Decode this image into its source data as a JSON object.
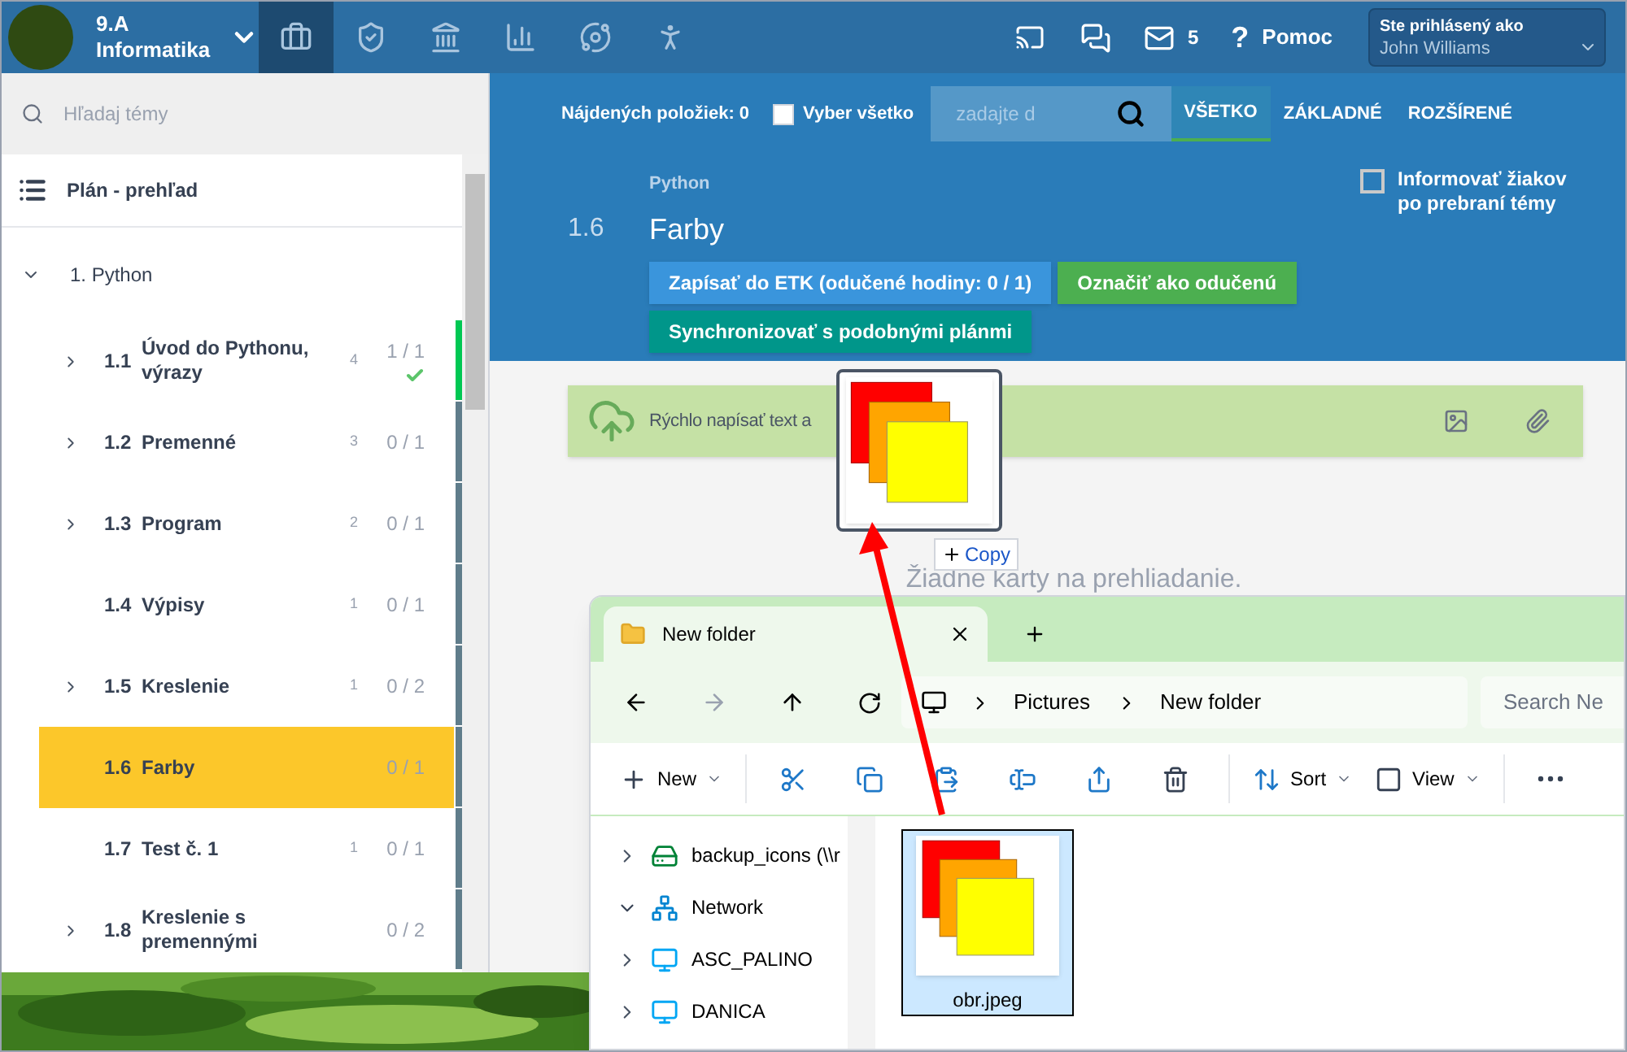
{
  "header": {
    "class_name": "9.A",
    "subject": "Informatika",
    "nav_tabs": [
      {
        "kind": "briefcase",
        "selected": true
      },
      {
        "kind": "shield",
        "selected": false
      },
      {
        "kind": "bank",
        "selected": false
      },
      {
        "kind": "chart",
        "selected": false
      },
      {
        "kind": "orbit",
        "selected": false
      },
      {
        "kind": "walkers",
        "selected": false
      }
    ],
    "messages_count": "5",
    "help_glyph": "?",
    "help": "Pomoc",
    "user": {
      "label": "Ste prihlásený ako",
      "name": "John Williams"
    }
  },
  "sidebar": {
    "search_placeholder": "Hľadaj témy",
    "overview": "Plán - prehľad",
    "group": {
      "title": "1. Python",
      "expanded": true,
      "items": [
        {
          "number": "1.1",
          "title": "Úvod do Pythonu, výrazy",
          "count": "4",
          "progress": "1 / 1",
          "done": true,
          "has_children": true,
          "selected": false
        },
        {
          "number": "1.2",
          "title": "Premenné",
          "count": "3",
          "progress": "0 / 1",
          "done": false,
          "has_children": true,
          "selected": false
        },
        {
          "number": "1.3",
          "title": "Program",
          "count": "2",
          "progress": "0 / 1",
          "done": false,
          "has_children": true,
          "selected": false
        },
        {
          "number": "1.4",
          "title": "Výpisy",
          "count": "1",
          "progress": "0 / 1",
          "done": false,
          "has_children": false,
          "selected": false
        },
        {
          "number": "1.5",
          "title": "Kreslenie",
          "count": "1",
          "progress": "0 / 2",
          "done": false,
          "has_children": true,
          "selected": false
        },
        {
          "number": "1.6",
          "title": "Farby",
          "progress": "0 / 1",
          "done": false,
          "has_children": false,
          "selected": true
        },
        {
          "number": "1.7",
          "title": "Test č. 1",
          "count": "1",
          "progress": "0 / 1",
          "done": false,
          "has_children": false,
          "selected": false
        },
        {
          "number": "1.8",
          "title": "Kreslenie s premennými",
          "progress": "0 / 2",
          "done": false,
          "has_children": true,
          "selected": false
        }
      ]
    }
  },
  "toolbar": {
    "found": "Nájdených položiek: 0",
    "select_all": {
      "label": "Vyber všetko",
      "checked": false
    },
    "search_placeholder": "zadajte d",
    "filters": [
      {
        "label": "VŠETKO",
        "selected": true
      },
      {
        "label": "ZÁKLADNÉ",
        "selected": false
      },
      {
        "label": "ROZŠÍRENÉ",
        "selected": false
      }
    ]
  },
  "topic": {
    "parent": "Python",
    "number": "1.6",
    "title": "Farby",
    "notify": {
      "label": "Informovať žiakov po prebraní témy",
      "checked": false
    },
    "buttons": [
      {
        "label": "Zapísať do ETK (odučené hodiny: 0 / 1)",
        "kind": "primary"
      },
      {
        "label": "Označiť ako odučenú",
        "kind": "success"
      },
      {
        "label": "Synchronizovať s podobnými plánmi",
        "kind": "teal"
      }
    ]
  },
  "quick_note": {
    "placeholder": "Rýchlo napísať text a"
  },
  "empty": "Žiadne karty na prehliadanie.",
  "drag": {
    "badge": "Copy"
  },
  "explorer": {
    "tab": "New folder",
    "breadcrumb": [
      "Pictures",
      "New folder"
    ],
    "search_placeholder": "Search Ne",
    "toolbar": [
      {
        "kind": "new",
        "label": "New"
      },
      {
        "kind": "cut"
      },
      {
        "kind": "copy"
      },
      {
        "kind": "paste"
      },
      {
        "kind": "rename"
      },
      {
        "kind": "share"
      },
      {
        "kind": "delete"
      },
      {
        "kind": "sort",
        "label": "Sort"
      },
      {
        "kind": "view",
        "label": "View"
      },
      {
        "kind": "more"
      }
    ],
    "nav": [
      {
        "label": "backup_icons (\\\\r",
        "kind": "drive",
        "expanded": false
      },
      {
        "label": "Network",
        "kind": "network",
        "expanded": true
      },
      {
        "label": "ASC_PALINO",
        "kind": "pc",
        "expanded": false
      },
      {
        "label": "DANICA",
        "kind": "pc",
        "expanded": false
      }
    ],
    "files": [
      {
        "name": "obr.jpeg",
        "selected": true
      }
    ]
  }
}
